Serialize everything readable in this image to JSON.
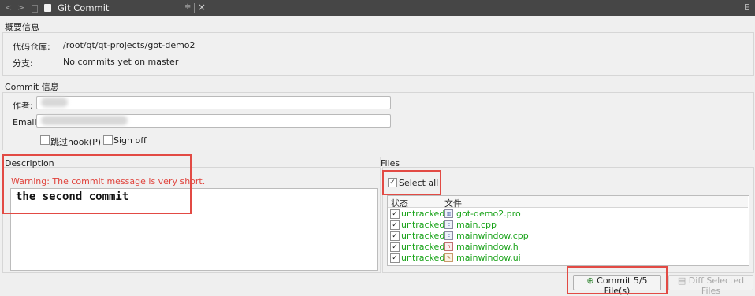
{
  "window": {
    "back_glyph": "<",
    "forward_glyph": ">",
    "tab_title": "Git Commit",
    "menu_glyph": "≑",
    "right_glyph": "E"
  },
  "summary": {
    "group_title": "概要信息",
    "repo_label": "代码仓库:",
    "repo_value": "/root/qt/qt-projects/got-demo2",
    "branch_label": "分支:",
    "branch_value": "No commits yet on master"
  },
  "commit_info": {
    "group_title": "Commit 信息",
    "author_label": "作者:",
    "email_label": "Email:",
    "skip_hook_label": "跳过hook(P)",
    "skip_hook_checked": false,
    "sign_off_label": "Sign off",
    "sign_off_checked": false
  },
  "description": {
    "title": "Description",
    "warning": "Warning: The commit message is very short.",
    "message": "the second commit",
    "colors": {
      "warning": "#e0433c",
      "highlight": "#e24a44"
    }
  },
  "files": {
    "title": "Files",
    "select_all_label": "Select all",
    "select_all_checked": true,
    "columns": [
      "状态",
      "文件"
    ],
    "rows": [
      {
        "checked": true,
        "status": "untracked",
        "icon": "qt-project-icon",
        "name": "got-demo2.pro"
      },
      {
        "checked": true,
        "status": "untracked",
        "icon": "cpp-file-icon",
        "name": "main.cpp"
      },
      {
        "checked": true,
        "status": "untracked",
        "icon": "cpp-file-icon",
        "name": "mainwindow.cpp"
      },
      {
        "checked": true,
        "status": "untracked",
        "icon": "header-file-icon",
        "name": "mainwindow.h"
      },
      {
        "checked": true,
        "status": "untracked",
        "icon": "ui-form-icon",
        "name": "mainwindow.ui"
      }
    ],
    "colors": {
      "untracked": "#19a319"
    }
  },
  "actions": {
    "commit_label": "Commit 5/5 File(s)",
    "diff_label": "Diff Selected Files"
  }
}
